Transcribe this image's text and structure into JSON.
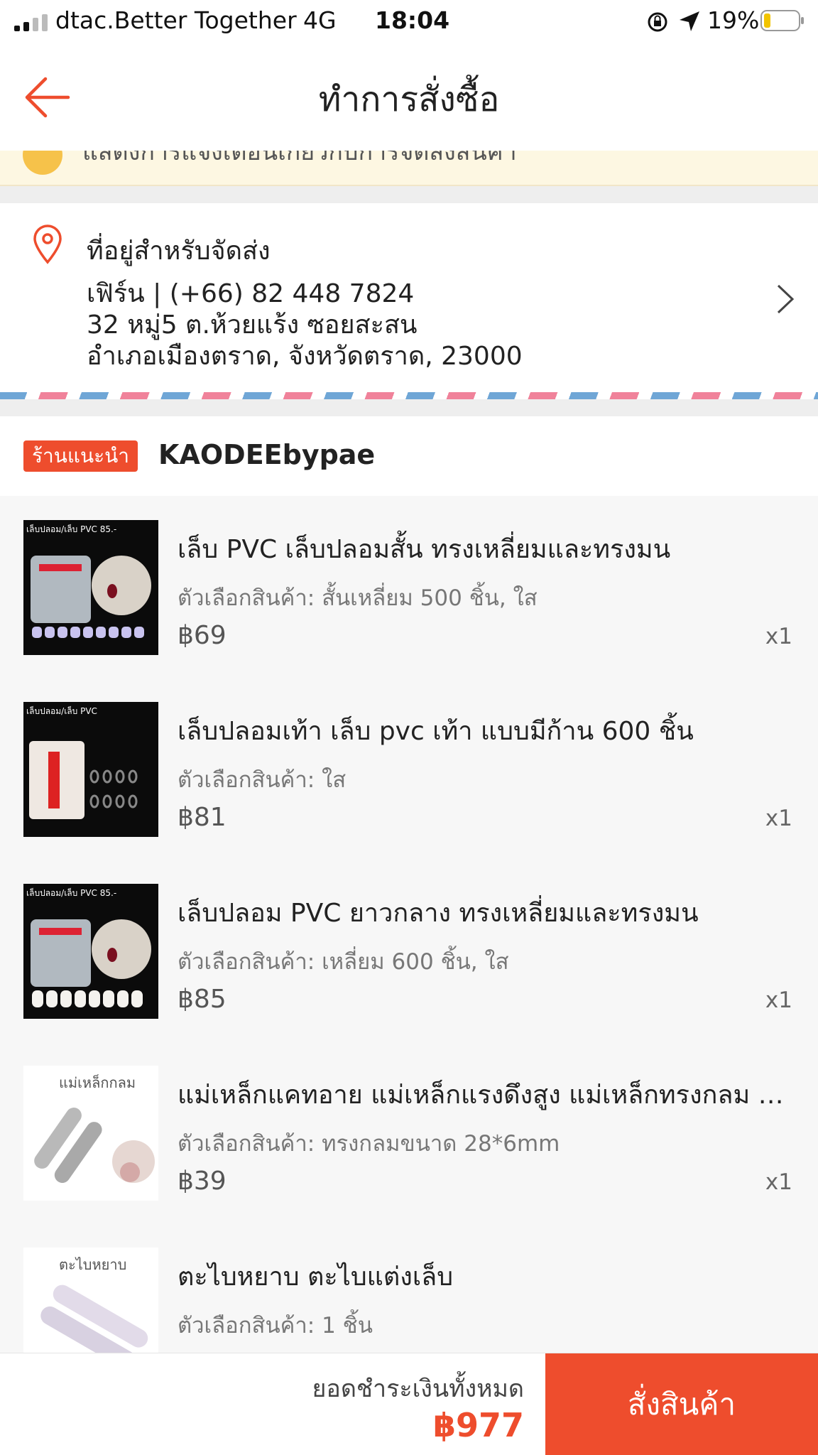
{
  "status_bar": {
    "carrier": "dtac.Better Together",
    "network": "4G",
    "time": "18:04",
    "battery": "19%",
    "battery_level": 0.19
  },
  "header": {
    "title": "ทำการสั่งซื้อ"
  },
  "notice": {
    "text": "แสดงการแจ้งเตือนเกี่ยวกับการจัดส่งสินค้า"
  },
  "address": {
    "heading": "ที่อยู่สำหรับจัดส่ง",
    "name_phone": "เฟิร์น | (+66) 82 448 7824",
    "line1": "32 หมู่5 ต.ห้วยแร้ง ซอยสะสน",
    "line2": "อำเภอเมืองตราด, จังหวัดตราด, 23000"
  },
  "shop": {
    "badge": "ร้านแนะนำ",
    "name": "KAODEEbypae"
  },
  "items": [
    {
      "name": "เล็บ PVC เล็บปลอมสั้น  ทรงเหลี่ยมและทรงมน",
      "variant": "ตัวเลือกสินค้า: สั้นเหลี่ยม 500 ชิ้น, ใส",
      "price": "฿69",
      "qty": "x1",
      "thumb_style": "dark",
      "thumb_label": "เล็บปลอม/เล็บ PVC 85.-"
    },
    {
      "name": "เล็บปลอมเท้า เล็บ pvc เท้า แบบมีก้าน 600 ชิ้น",
      "variant": "ตัวเลือกสินค้า: ใส",
      "price": "฿81",
      "qty": "x1",
      "thumb_style": "dark",
      "thumb_label": "เล็บปลอม/เล็บ PVC"
    },
    {
      "name": "เล็บปลอม PVC ยาวกลาง ทรงเหลี่ยมและทรงมน",
      "variant": "ตัวเลือกสินค้า: เหลี่ยม 600 ชิ้น, ใส",
      "price": "฿85",
      "qty": "x1",
      "thumb_style": "dark",
      "thumb_label": "เล็บปลอม/เล็บ PVC 85.-"
    },
    {
      "name": "แม่เหล็กแคทอาย แม่เหล็กแรงดึงสูง แม่เหล็กทรงกลม แม่เหล็กทรงยาว",
      "variant": "ตัวเลือกสินค้า: ทรงกลมขนาด 28*6mm",
      "price": "฿39",
      "qty": "x1",
      "thumb_style": "light",
      "thumb_label": "แม่เหล็กกลม"
    },
    {
      "name": "ตะไบหยาบ ตะไบแต่งเล็บ",
      "variant": "ตัวเลือกสินค้า: 1 ชิ้น",
      "price": "",
      "qty": "",
      "thumb_style": "light",
      "thumb_label": "ตะไบหยาบ"
    }
  ],
  "footer": {
    "total_label": "ยอดชำระเงินทั้งหมด",
    "total_amount": "฿977",
    "order_button": "สั่งสินค้า"
  },
  "colors": {
    "accent": "#ee4d2d",
    "notice_bg": "#fdf7e2"
  }
}
